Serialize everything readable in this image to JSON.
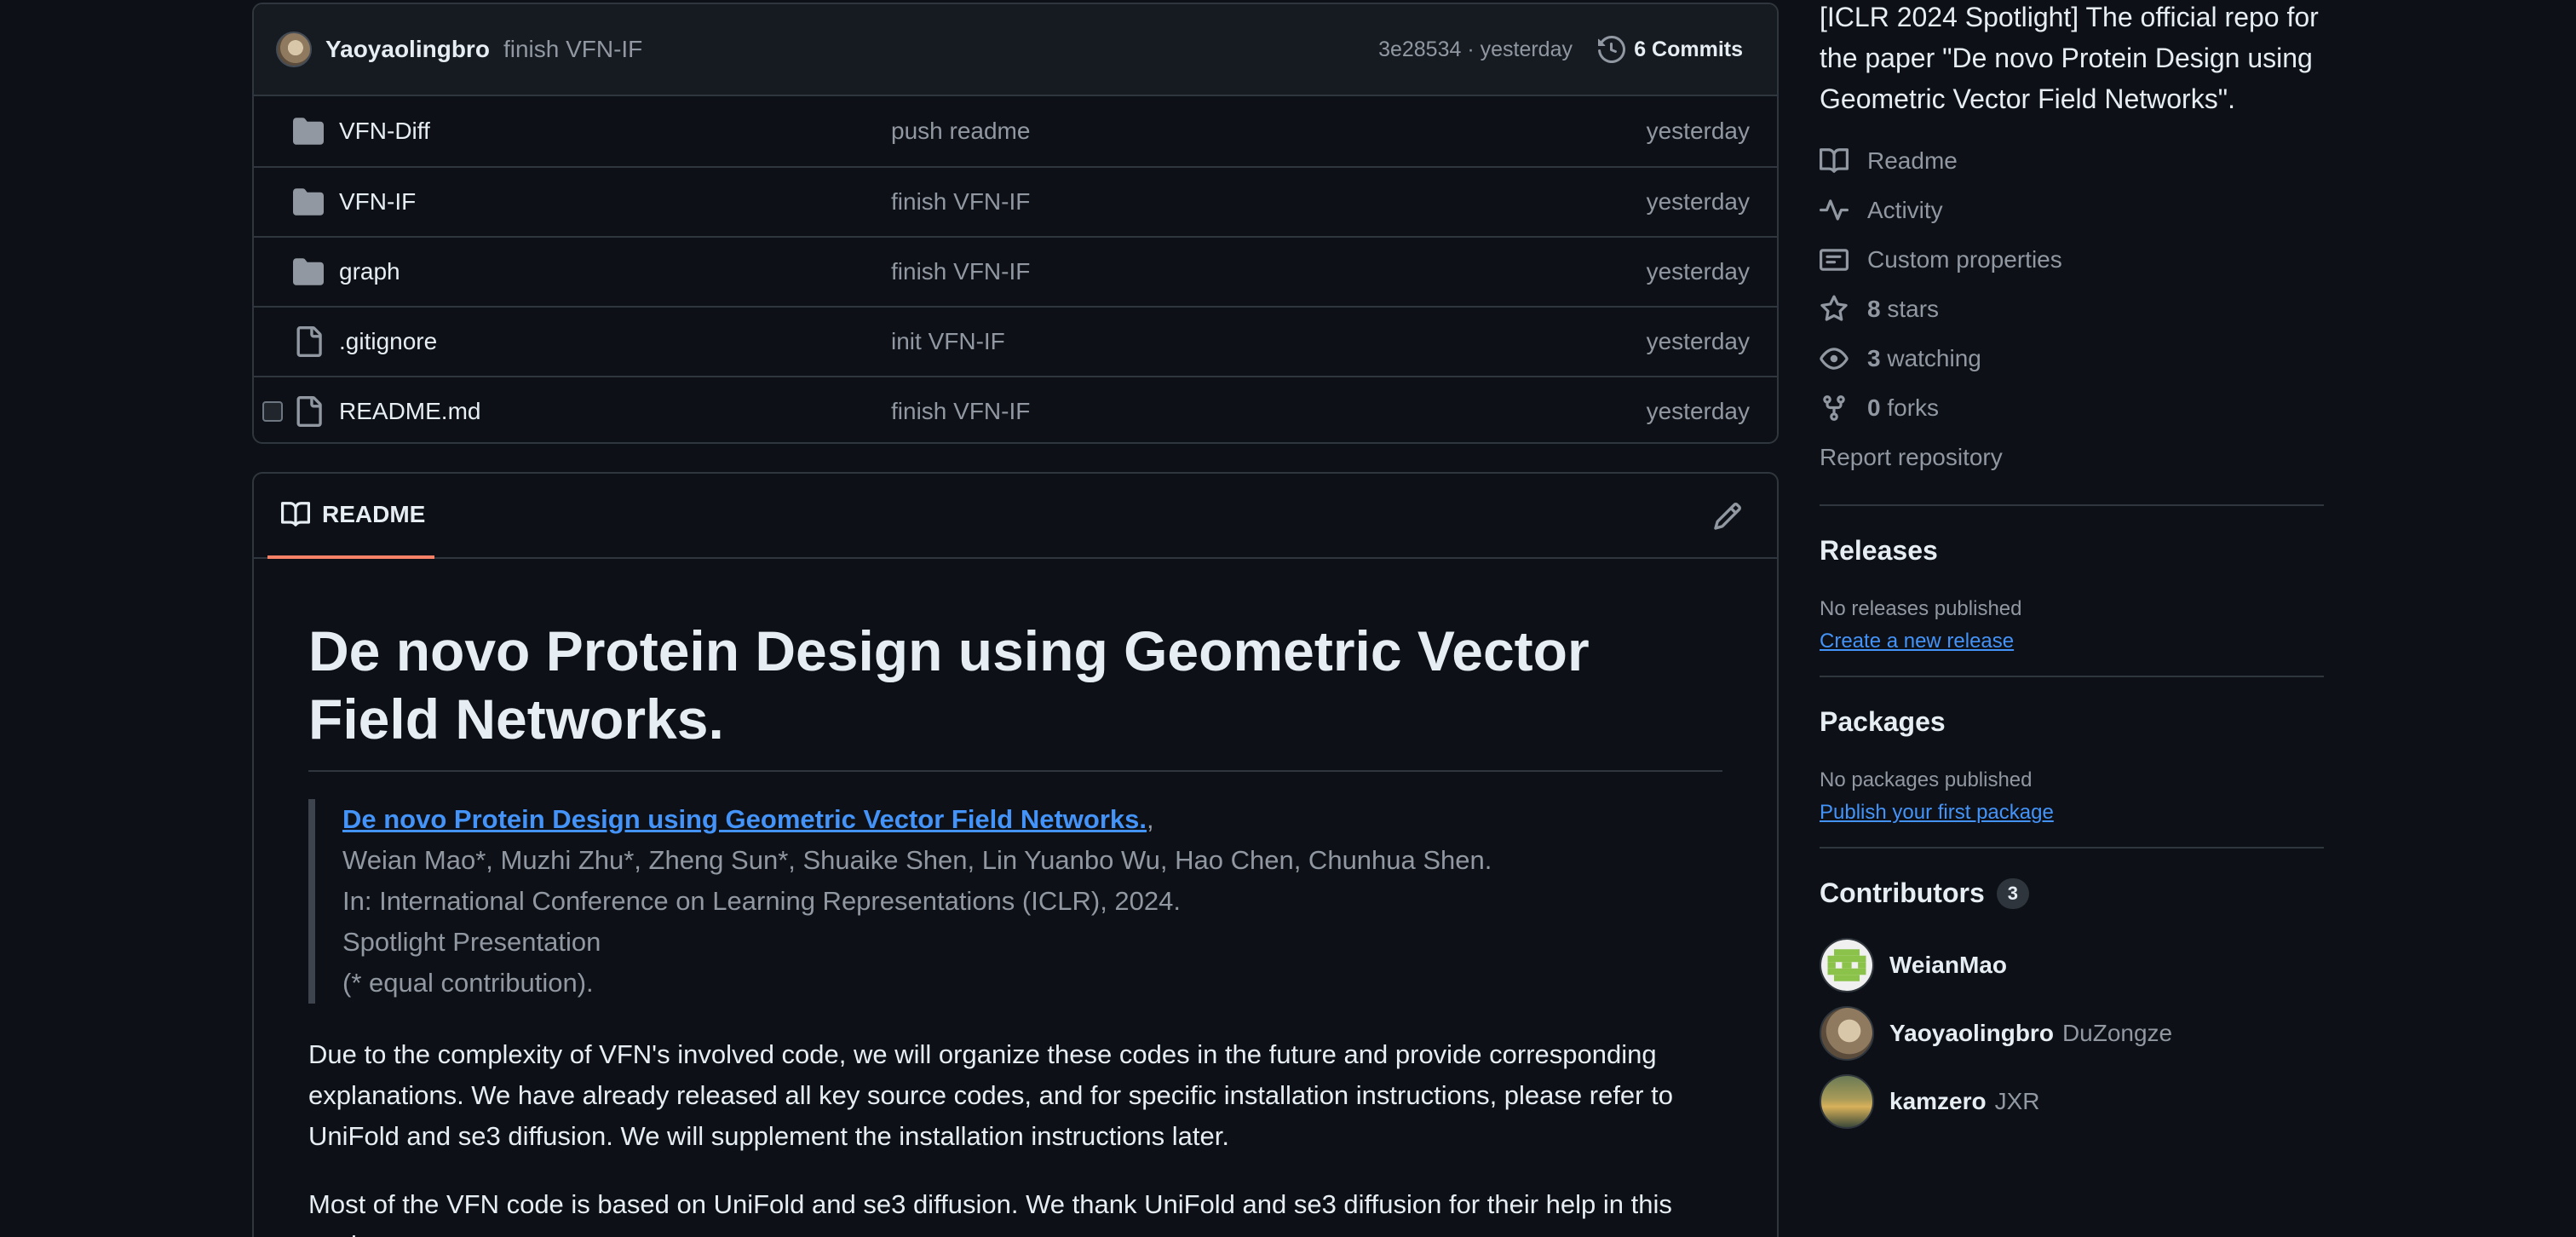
{
  "latest_commit": {
    "author": "Yaoyaolingbro",
    "message": "finish VFN-IF",
    "meta": "3e28534 · yesterday",
    "commits_label": "6 Commits"
  },
  "files": [
    {
      "name": "VFN-Diff",
      "type": "folder",
      "commit": "push readme",
      "date": "yesterday"
    },
    {
      "name": "VFN-IF",
      "type": "folder",
      "commit": "finish VFN-IF",
      "date": "yesterday"
    },
    {
      "name": "graph",
      "type": "folder",
      "commit": "finish VFN-IF",
      "date": "yesterday"
    },
    {
      "name": ".gitignore",
      "type": "file",
      "commit": "init VFN-IF",
      "date": "yesterday"
    },
    {
      "name": "README.md",
      "type": "file",
      "commit": "finish VFN-IF",
      "date": "yesterday"
    }
  ],
  "readme": {
    "tab_label": "README",
    "title": "De novo Protein Design using Geometric Vector Field Networks.",
    "quote": {
      "paper_link": "De novo Protein Design using Geometric Vector Field Networks.",
      "link_suffix": ",",
      "authors": "Weian Mao*, Muzhi Zhu*, Zheng Sun*, Shuaike Shen, Lin Yuanbo Wu, Hao Chen, Chunhua Shen.",
      "venue": "In: International Conference on Learning Representations (ICLR), 2024.",
      "presentation": "Spotlight Presentation",
      "note": "(* equal contribution)."
    },
    "para1": "Due to the complexity of VFN's involved code, we will organize these codes in the future and provide corresponding explanations. We have already released all key source codes, and for specific installation instructions, please refer to UniFold and se3 diffusion. We will supplement the installation instructions later.",
    "para2": "Most of the VFN code is based on UniFold and se3 diffusion. We thank UniFold and se3 diffusion for their help in this work."
  },
  "sidebar": {
    "about": "[ICLR 2024 Spotlight] The official repo for the paper \"De novo Protein Design using Geometric Vector Field Networks\".",
    "readme_label": "Readme",
    "activity_label": "Activity",
    "custom_properties_label": "Custom properties",
    "stars_count": "8",
    "stars_label": "stars",
    "watching_count": "3",
    "watching_label": "watching",
    "forks_count": "0",
    "forks_label": "forks",
    "report_label": "Report repository",
    "releases": {
      "heading": "Releases",
      "note": "No releases published",
      "link": "Create a new release"
    },
    "packages": {
      "heading": "Packages",
      "note": "No packages published",
      "link": "Publish your first package"
    },
    "contributors": {
      "heading": "Contributors",
      "count": "3",
      "people": [
        {
          "login": "WeianMao",
          "name": ""
        },
        {
          "login": "Yaoyaolingbro",
          "name": "DuZongze"
        },
        {
          "login": "kamzero",
          "name": "JXR"
        }
      ]
    }
  },
  "colors": {
    "background": "#0d1117",
    "border": "#30363d",
    "muted_text": "#9198a1",
    "link": "#4493f8",
    "tab_underline": "#f78166"
  }
}
